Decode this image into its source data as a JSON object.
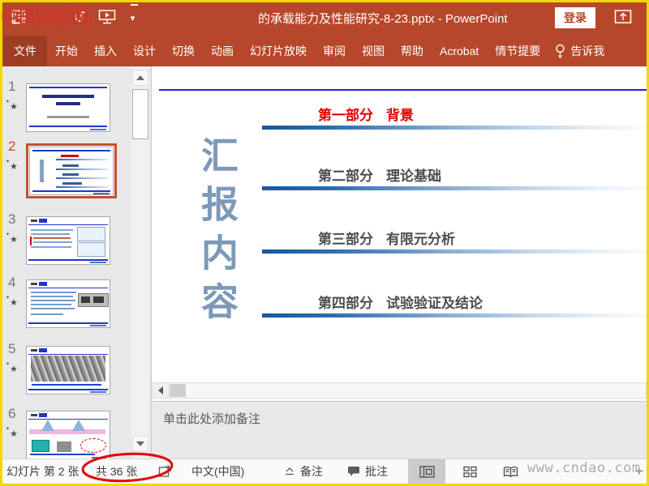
{
  "titlebar": {
    "title": "的承载能力及性能研究-8-23.pptx - PowerPoint",
    "login": "登录"
  },
  "ribbon": {
    "tabs": [
      "文件",
      "开始",
      "插入",
      "设计",
      "切换",
      "动画",
      "幻灯片放映",
      "审阅",
      "视图",
      "帮助",
      "Acrobat",
      "情节提要"
    ],
    "tell_me": "告诉我"
  },
  "sidebar": {
    "slides": [
      {
        "number": "1"
      },
      {
        "number": "2"
      },
      {
        "number": "3"
      },
      {
        "number": "4"
      },
      {
        "number": "5"
      },
      {
        "number": "6"
      }
    ],
    "selected_slide": "2"
  },
  "slide": {
    "vertical_title": "汇报内容",
    "sections": [
      {
        "label": "第一部分",
        "title": "背景"
      },
      {
        "label": "第二部分",
        "title": "理论基础"
      },
      {
        "label": "第三部分",
        "title": "有限元分析"
      },
      {
        "label": "第四部分",
        "title": "试验验证及结论"
      }
    ]
  },
  "notes_pane": {
    "placeholder": "单击此处添加备注"
  },
  "statusbar": {
    "slide_position": "幻灯片 第 2 张",
    "slide_total": "共 36 张",
    "language": "中文(中国)",
    "notes": "备注",
    "comments": "批注",
    "zoom_plus": "+"
  },
  "watermarks": {
    "site_name": "中国道桥网",
    "site_url": "www.cndao.com"
  },
  "colors": {
    "brand_red": "#B7472A",
    "selection_orange": "#C0512D",
    "slide_line_blue": "#2021CE",
    "section_red": "#E00202",
    "gradient_blue": "#17599E",
    "annotation_red": "#E60000",
    "border_yellow": "#F2D702"
  }
}
